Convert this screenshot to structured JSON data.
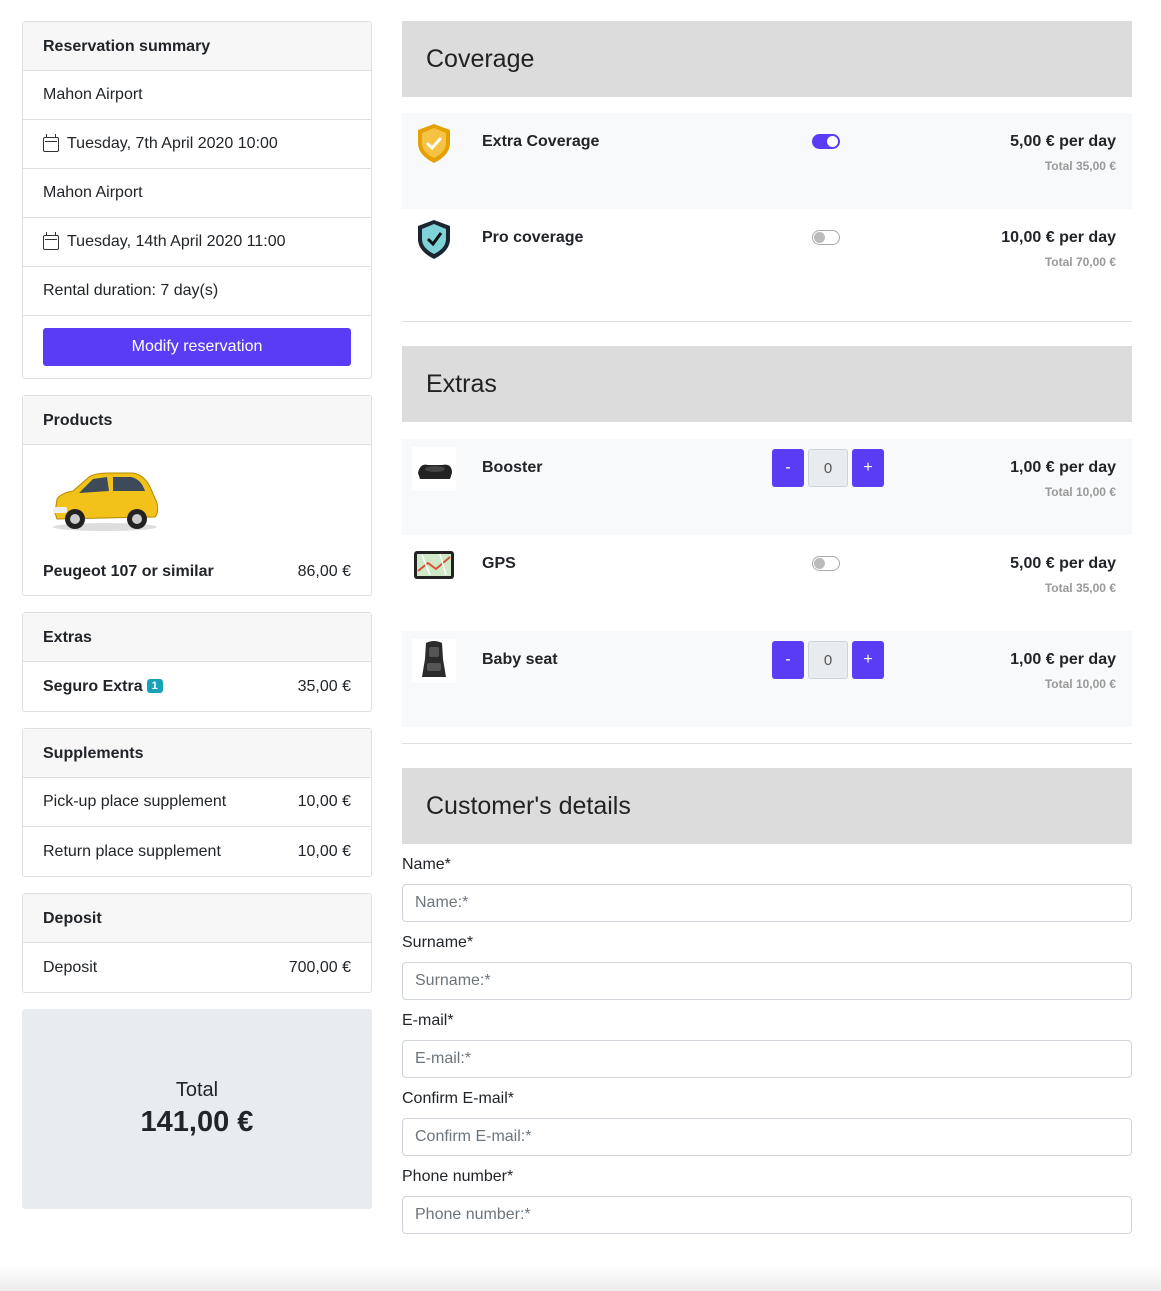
{
  "summary": {
    "header": "Reservation summary",
    "pickup_place": "Mahon Airport",
    "pickup_date": "Tuesday, 7th April 2020 10:00",
    "return_place": "Mahon Airport",
    "return_date": "Tuesday, 14th April 2020 11:00",
    "duration": "Rental duration: 7 day(s)",
    "modify_label": "Modify reservation"
  },
  "products": {
    "header": "Products",
    "name": "Peugeot 107 or similar",
    "price": "86,00 €"
  },
  "extras_card": {
    "header": "Extras",
    "item_name": "Seguro Extra",
    "item_badge": "1",
    "item_price": "35,00 €"
  },
  "supplements": {
    "header": "Supplements",
    "items": [
      {
        "label": "Pick-up place supplement",
        "price": "10,00 €"
      },
      {
        "label": "Return place supplement",
        "price": "10,00 €"
      }
    ]
  },
  "deposit": {
    "header": "Deposit",
    "label": "Deposit",
    "price": "700,00 €"
  },
  "total": {
    "label": "Total",
    "amount": "141,00 €"
  },
  "coverage": {
    "title": "Coverage",
    "items": [
      {
        "name": "Extra Coverage",
        "price": "5,00 € per day",
        "total": "Total 35,00 €",
        "enabled": true,
        "icon": "shield-check-gold-icon"
      },
      {
        "name": "Pro coverage",
        "price": "10,00 € per day",
        "total": "Total 70,00 €",
        "enabled": false,
        "icon": "shield-check-blue-icon"
      }
    ]
  },
  "extras": {
    "title": "Extras",
    "items": [
      {
        "name": "Booster",
        "price": "1,00 € per day",
        "total": "Total 10,00 €",
        "quantity": "0",
        "minus": "-",
        "plus": "+",
        "icon": "booster-seat-icon"
      },
      {
        "name": "GPS",
        "price": "5,00 € per day",
        "total": "Total 35,00 €",
        "enabled": false,
        "icon": "gps-device-icon"
      },
      {
        "name": "Baby seat",
        "price": "1,00 € per day",
        "total": "Total 10,00 €",
        "quantity": "0",
        "minus": "-",
        "plus": "+",
        "icon": "baby-seat-icon"
      }
    ]
  },
  "customer": {
    "title": "Customer's details",
    "fields": [
      {
        "label": "Name*",
        "placeholder": "Name:*"
      },
      {
        "label": "Surname*",
        "placeholder": "Surname:*"
      },
      {
        "label": "E-mail*",
        "placeholder": "E-mail:*"
      },
      {
        "label": "Confirm E-mail*",
        "placeholder": "Confirm E-mail:*"
      },
      {
        "label": "Phone number*",
        "placeholder": "Phone number:*"
      }
    ]
  },
  "colors": {
    "accent": "#5b3cf5",
    "badge": "#17a2b8",
    "section_header_bg": "#dcdcdc"
  }
}
